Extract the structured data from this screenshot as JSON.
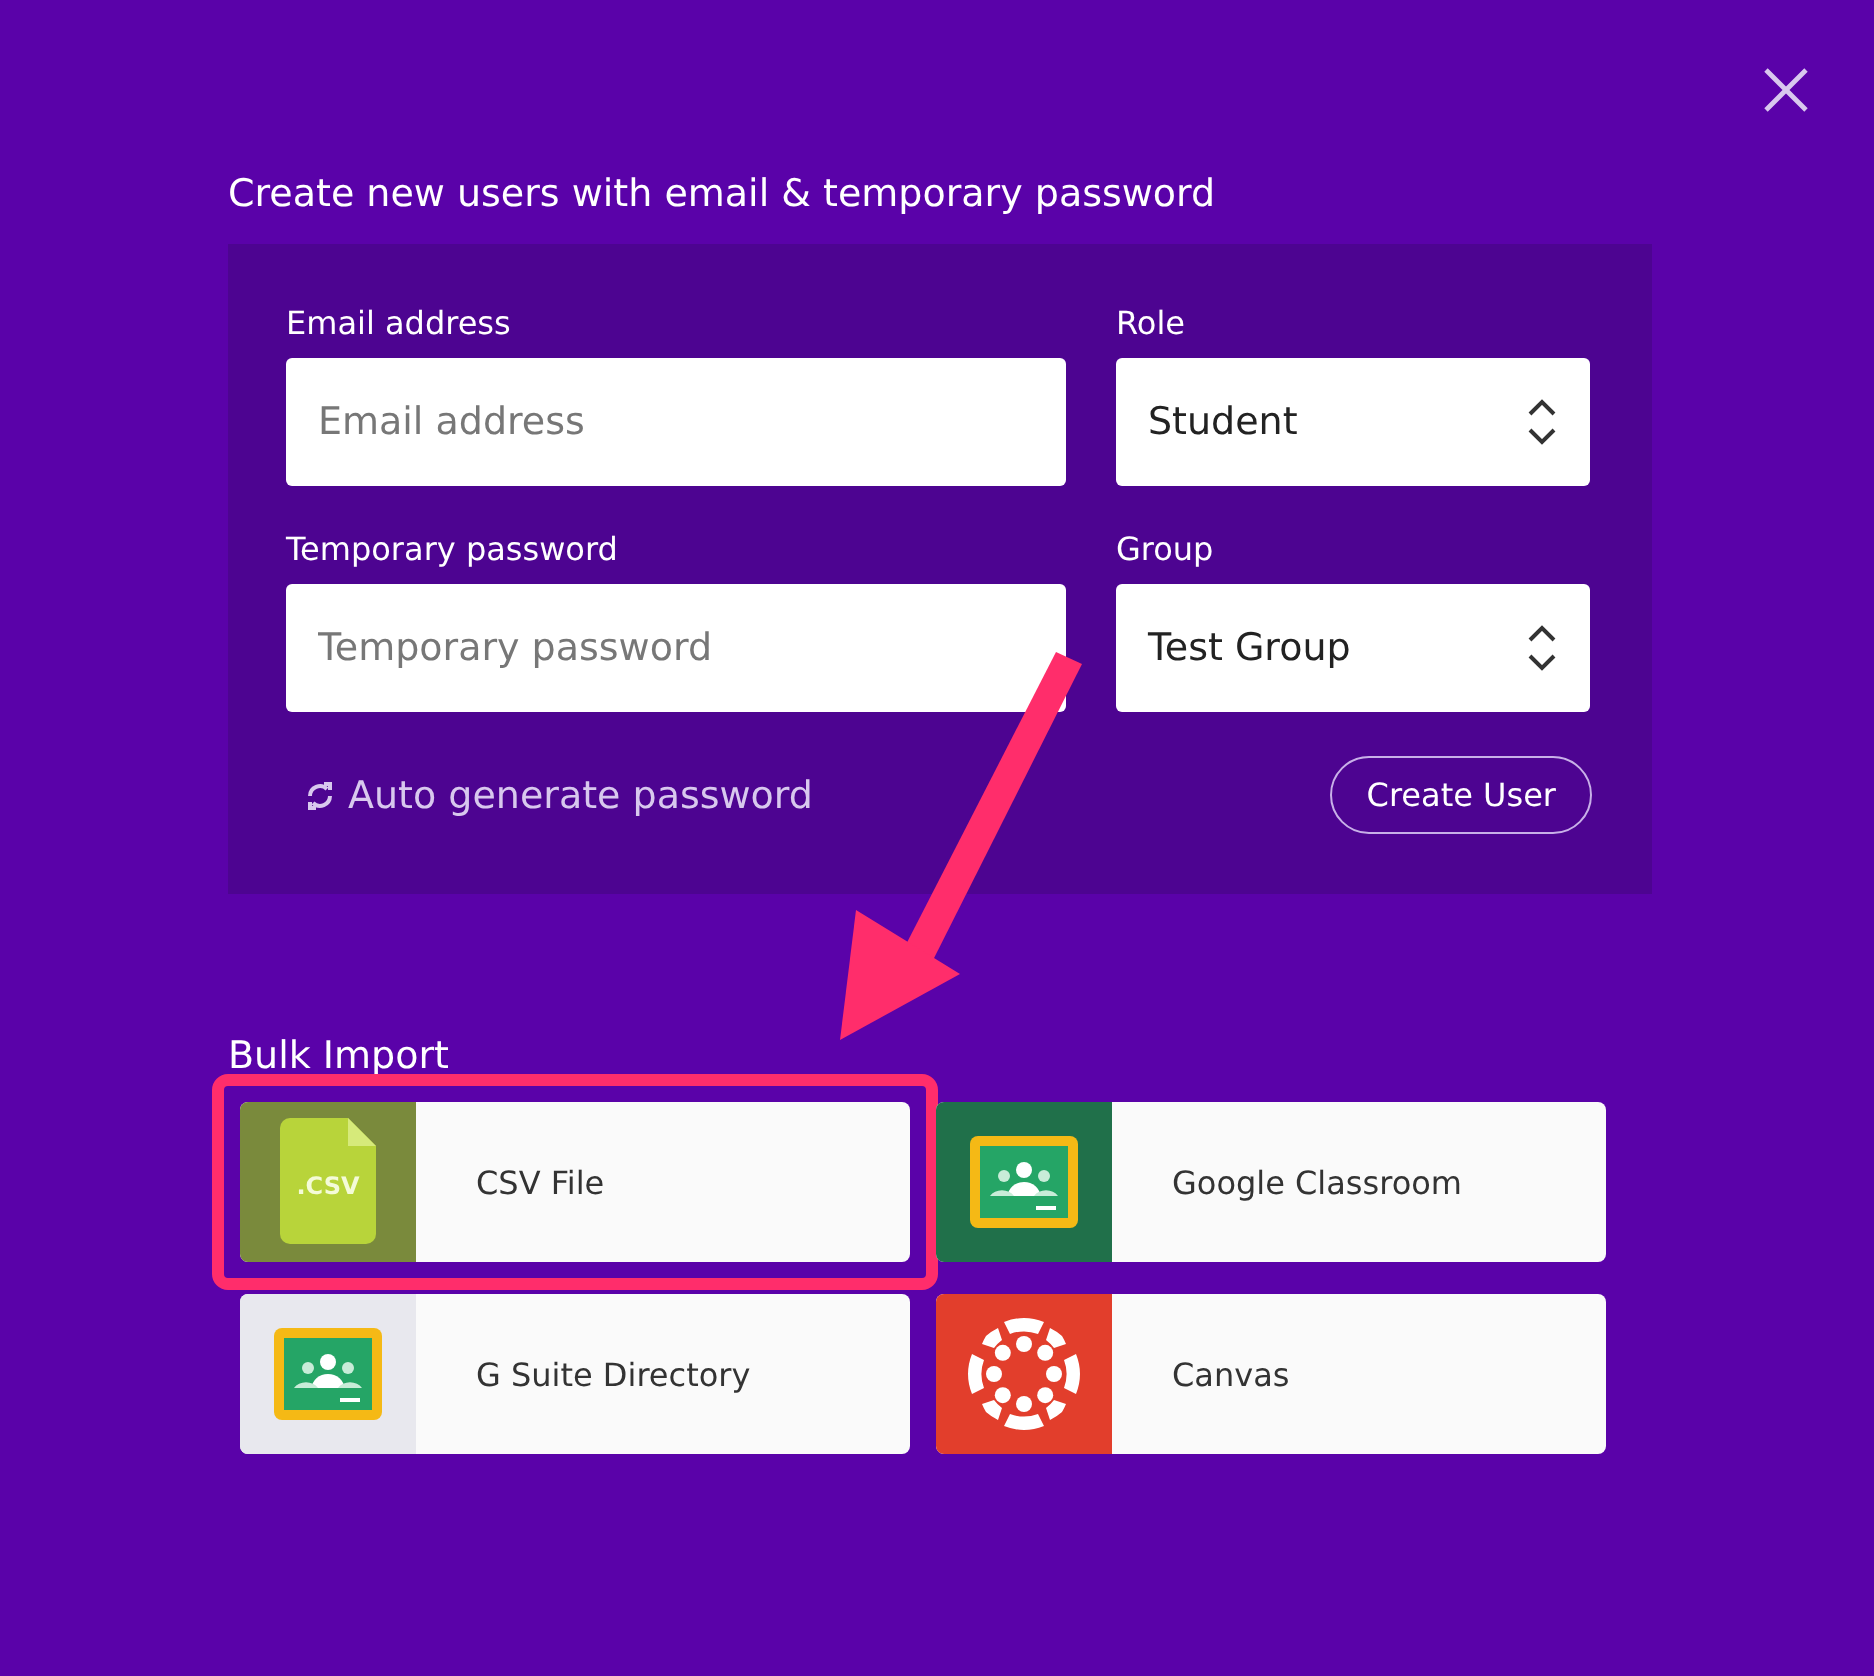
{
  "title": "Create new users with email & temporary password",
  "form": {
    "fields": [
      {
        "kind": "text",
        "label": "Email address",
        "placeholder": "Email address"
      },
      {
        "kind": "select",
        "label": "Role",
        "value": "Student"
      },
      {
        "kind": "text",
        "label": "Temporary password",
        "placeholder": "Temporary password"
      },
      {
        "kind": "select",
        "label": "Group",
        "value": "Test Group"
      }
    ],
    "auto_generate": "Auto generate password",
    "create_button": "Create User"
  },
  "bulk_import": {
    "title": "Bulk Import",
    "items": [
      {
        "label": "CSV File",
        "kind": "csv",
        "icon_text": ".CSV",
        "color": "#7a8a3c",
        "highlighted": true
      },
      {
        "label": "Google Classroom",
        "kind": "classroom",
        "color": "#20704a",
        "highlighted": false
      },
      {
        "label": "G Suite Directory",
        "kind": "classroom",
        "color": "#e8e8ee",
        "highlighted": false
      },
      {
        "label": "Canvas",
        "kind": "canvas",
        "color": "#e23e2c",
        "highlighted": false
      }
    ]
  },
  "annotation_arrow": true
}
